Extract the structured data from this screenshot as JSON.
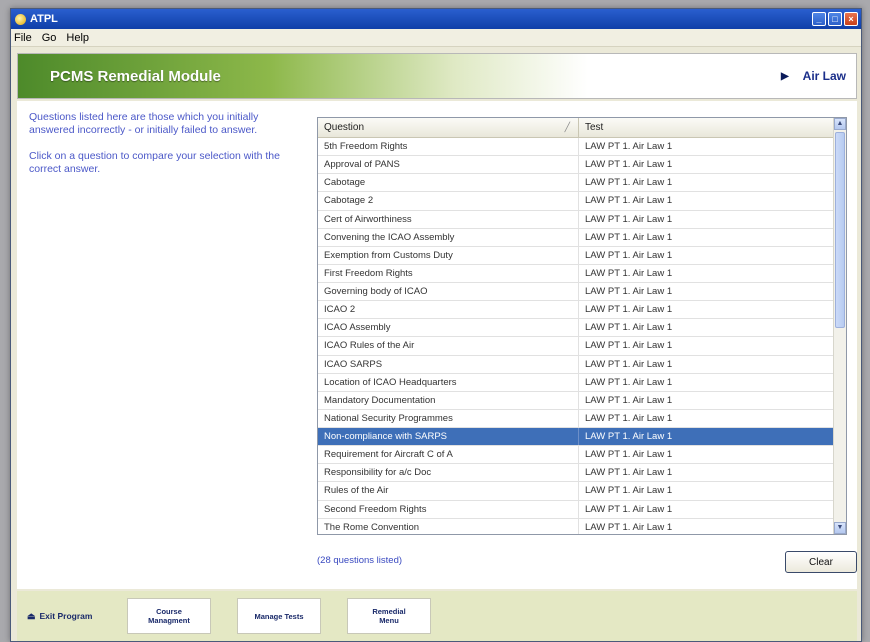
{
  "window": {
    "title": "ATPL"
  },
  "menu": {
    "items": [
      "File",
      "Go",
      "Help"
    ]
  },
  "banner": {
    "title": "PCMS Remedial Module",
    "subject": "Air Law"
  },
  "instructions": {
    "p1": "Questions listed here are those which you initially answered incorrectly - or initially failed to answer.",
    "p2": "Click on a question to compare your selection with the correct answer."
  },
  "grid": {
    "columns": {
      "question": "Question",
      "test": "Test"
    },
    "rows": [
      {
        "question": "5th Freedom Rights",
        "test": "LAW PT 1. Air Law 1"
      },
      {
        "question": "Approval of PANS",
        "test": "LAW PT 1. Air Law 1"
      },
      {
        "question": "Cabotage",
        "test": "LAW PT 1. Air Law 1"
      },
      {
        "question": "Cabotage 2",
        "test": "LAW PT 1. Air Law 1"
      },
      {
        "question": "Cert of Airworthiness",
        "test": "LAW PT 1. Air Law 1"
      },
      {
        "question": "Convening the ICAO Assembly",
        "test": "LAW PT 1. Air Law 1"
      },
      {
        "question": "Exemption from Customs Duty",
        "test": "LAW PT 1. Air Law 1"
      },
      {
        "question": "First Freedom Rights",
        "test": "LAW PT 1. Air Law 1"
      },
      {
        "question": "Governing body of ICAO",
        "test": "LAW PT 1. Air Law 1"
      },
      {
        "question": "ICAO 2",
        "test": "LAW PT 1. Air Law 1"
      },
      {
        "question": "ICAO Assembly",
        "test": "LAW PT 1. Air Law 1"
      },
      {
        "question": "ICAO Rules of the Air",
        "test": "LAW PT 1. Air Law 1"
      },
      {
        "question": "ICAO SARPS",
        "test": "LAW PT 1. Air Law 1"
      },
      {
        "question": "Location of ICAO Headquarters",
        "test": "LAW PT 1. Air Law 1"
      },
      {
        "question": "Mandatory Documentation",
        "test": "LAW PT 1. Air Law 1"
      },
      {
        "question": "National Security Programmes",
        "test": "LAW PT 1. Air Law 1"
      },
      {
        "question": "Non-compliance with SARPS",
        "test": "LAW PT 1. Air Law 1",
        "selected": true
      },
      {
        "question": "Requirement for Aircraft C of A",
        "test": "LAW PT 1. Air Law 1"
      },
      {
        "question": "Responsibility for a/c Doc",
        "test": "LAW PT 1. Air Law 1"
      },
      {
        "question": "Rules of the Air",
        "test": "LAW PT 1. Air Law 1"
      },
      {
        "question": "Second Freedom Rights",
        "test": "LAW PT 1. Air Law 1"
      },
      {
        "question": "The Rome Convention",
        "test": "LAW PT 1. Air Law 1"
      }
    ],
    "count_label": "(28 questions listed)"
  },
  "buttons": {
    "clear": "Clear"
  },
  "footer": {
    "exit": "Exit Program",
    "course": "Course\nManagment",
    "manage_tests": "Manage Tests",
    "remedial": "Remedial\nMenu"
  },
  "colors": {
    "selection": "#3e6fb8",
    "instruction_text": "#4b58c8",
    "banner_green": "#4d8a2a"
  }
}
